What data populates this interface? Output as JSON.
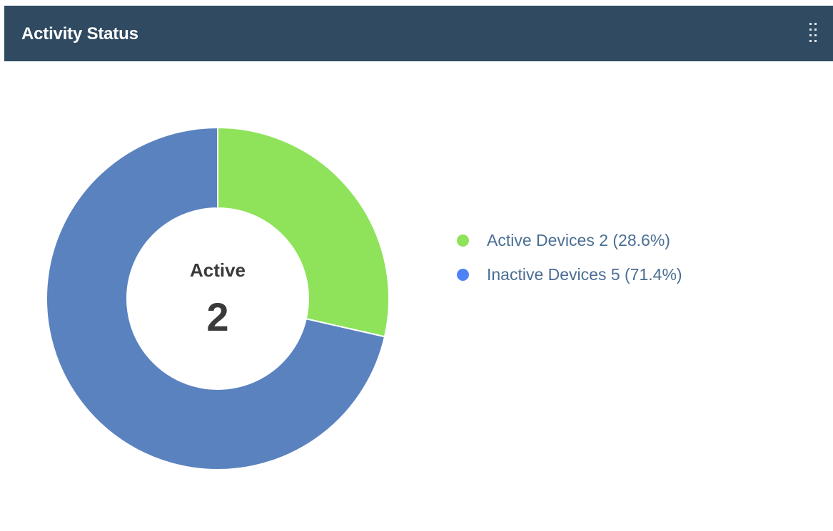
{
  "widget": {
    "title": "Activity Status"
  },
  "chart_data": {
    "type": "pie",
    "categories": [
      "Active Devices",
      "Inactive Devices"
    ],
    "values": [
      2,
      5
    ],
    "percentages": [
      "28.6%",
      "71.4%"
    ],
    "colors": [
      "#8ee35a",
      "#5a82bf"
    ],
    "legend_dot_colors": [
      "#8ee35a",
      "#4f83f5"
    ],
    "legend_placement": "right",
    "donut": true,
    "center": {
      "label": "Active",
      "value": "2"
    },
    "legend": [
      {
        "label": "Active Devices 2 (28.6%)"
      },
      {
        "label": "Inactive Devices 5 (71.4%)"
      }
    ]
  }
}
